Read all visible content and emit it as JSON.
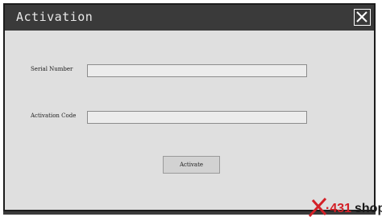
{
  "window": {
    "title": "Activation",
    "close_icon": "close-icon"
  },
  "form": {
    "serial_label": "Serial Number",
    "serial_value": "",
    "code_label": "Activation Code",
    "code_value": "",
    "activate_label": "Activate"
  },
  "watermark": {
    "text": "X-431shop",
    "colors": {
      "x": "#d32027",
      "text": "#1a1a1a"
    }
  },
  "colors": {
    "titlebar": "#3a3a3a",
    "body": "#dfdfdf",
    "field": "#ececec"
  }
}
